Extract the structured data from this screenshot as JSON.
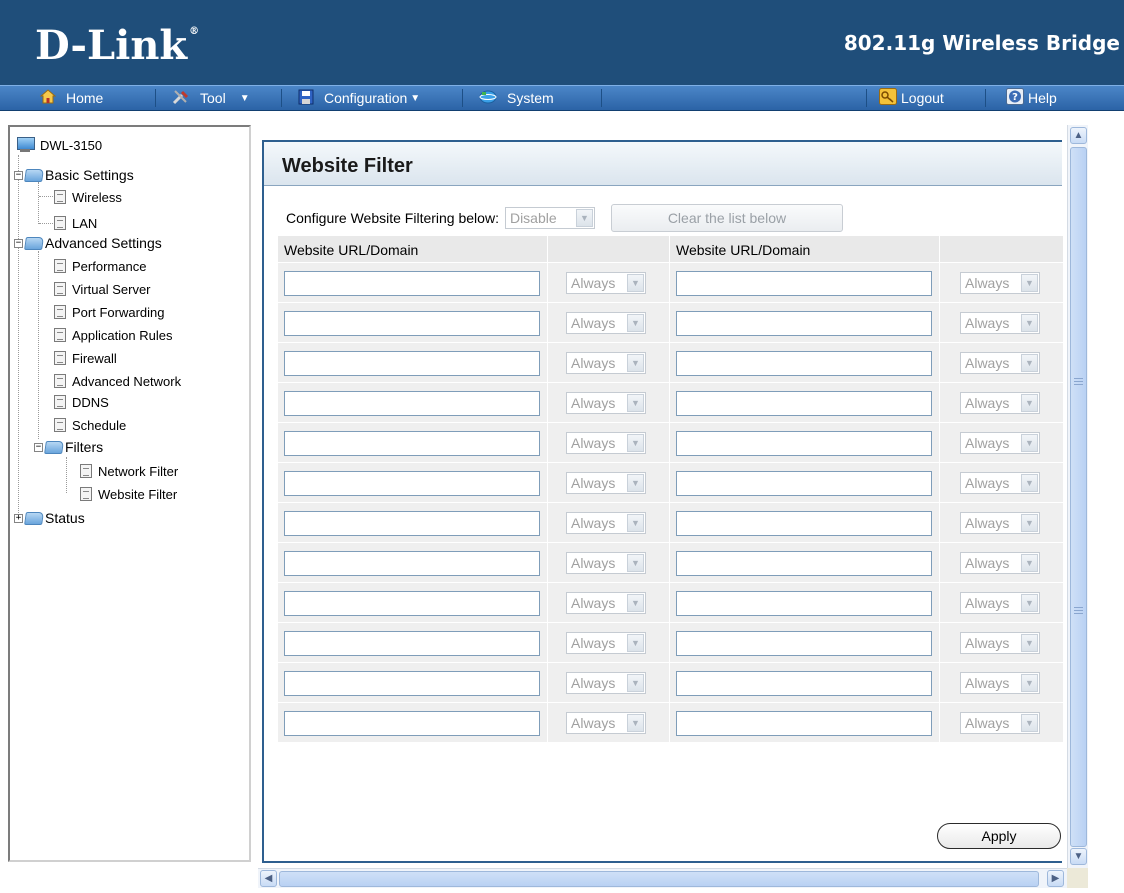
{
  "header": {
    "logo": "D-Link",
    "logo_mark": "®",
    "product": "802.11g Wireless Bridge"
  },
  "menu": {
    "home": "Home",
    "tool": "Tool",
    "configuration": "Configuration",
    "system": "System",
    "logout": "Logout",
    "help": "Help",
    "icons": {
      "home": "home-icon",
      "tool": "tool-icon",
      "configuration": "save-disk-icon",
      "system": "globe-icon",
      "logout": "key-icon",
      "help": "help-icon"
    }
  },
  "tree": {
    "root": "DWL-3150",
    "basic": "Basic Settings",
    "wireless": "Wireless",
    "lan": "LAN",
    "advanced": "Advanced Settings",
    "performance": "Performance",
    "virtual_server": "Virtual Server",
    "port_forwarding": "Port Forwarding",
    "application_rules": "Application Rules",
    "firewall": "Firewall",
    "advanced_network": "Advanced Network",
    "ddns": "DDNS",
    "schedule": "Schedule",
    "filters": "Filters",
    "network_filter": "Network Filter",
    "website_filter": "Website Filter",
    "status": "Status"
  },
  "page": {
    "title": "Website Filter",
    "config_label": "Configure Website Filtering below:",
    "config_select": "Disable",
    "clear_button": "Clear the list below",
    "col_url_left": "Website URL/Domain",
    "col_url_right": "Website URL/Domain",
    "schedule_value": "Always",
    "row_count": 12,
    "apply": "Apply"
  },
  "colors": {
    "header_bg": "#1f4e7a",
    "menubar": "#3a74b8",
    "panel_border": "#2e5f8f"
  }
}
